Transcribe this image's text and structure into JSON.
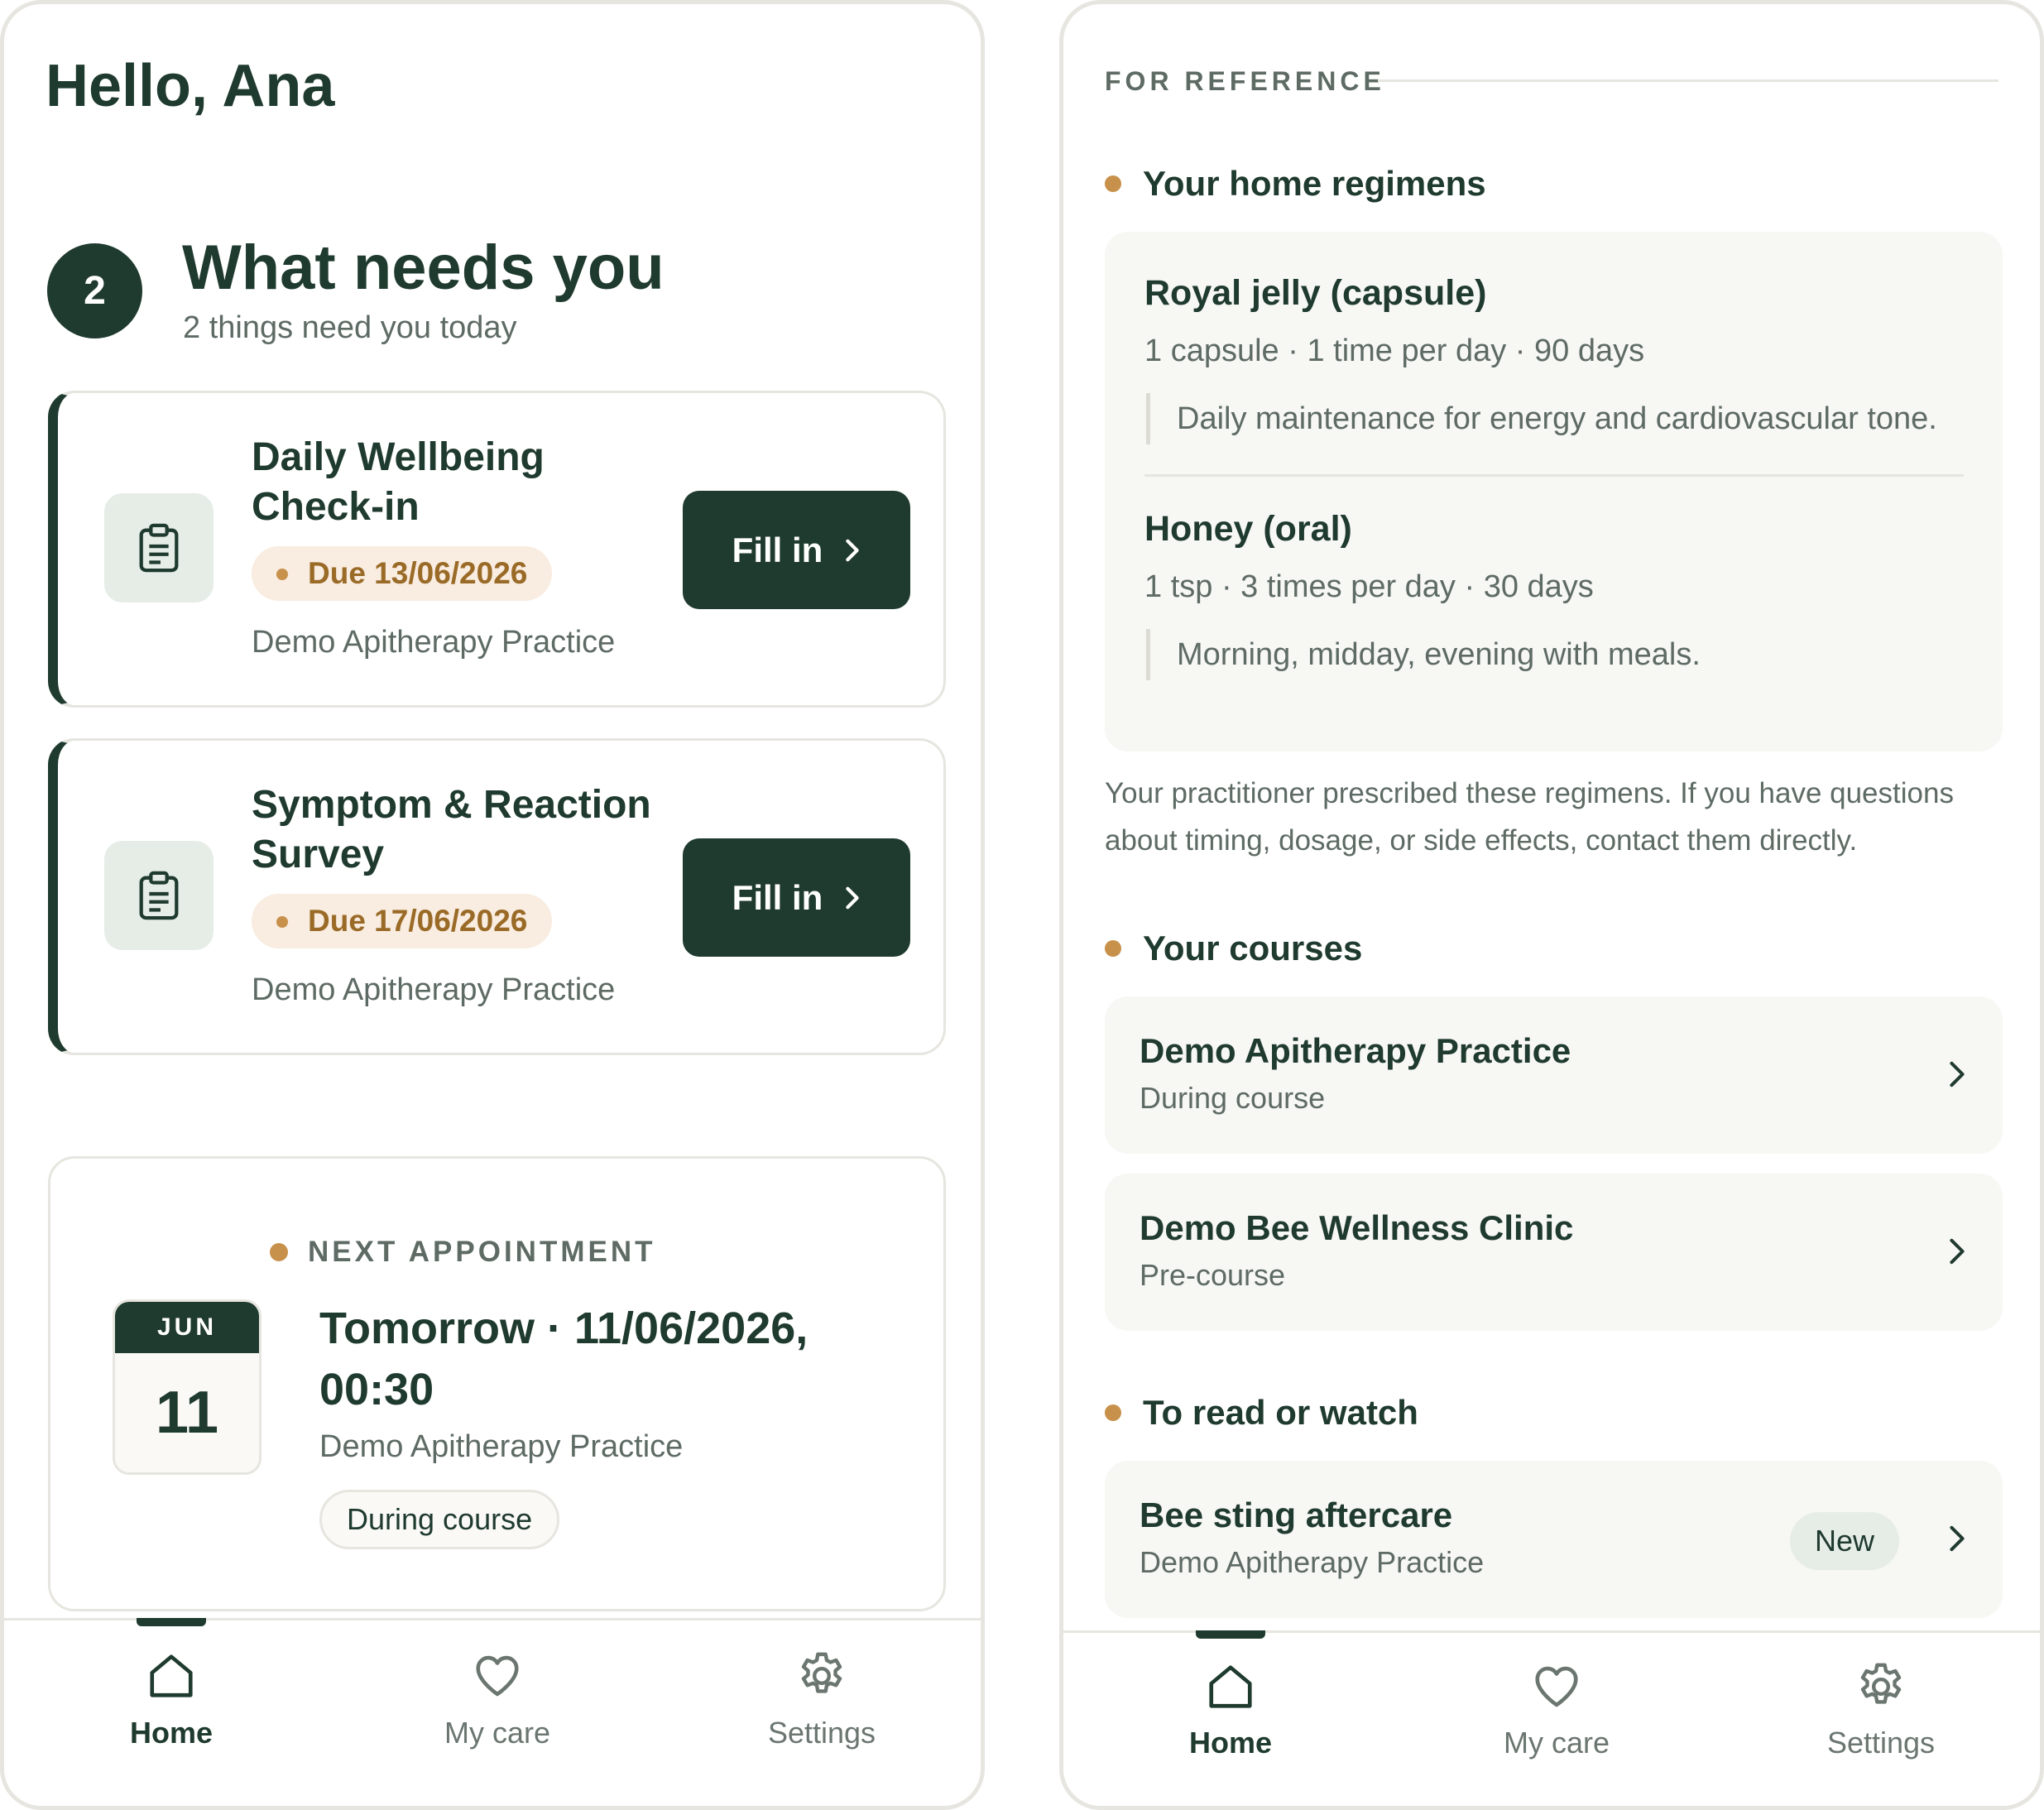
{
  "colors": {
    "primary": "#1f3a2e",
    "accent": "#c8914b",
    "due_bg": "#f9ece0",
    "due_text": "#9a6a27",
    "muted": "#5e6b64"
  },
  "left": {
    "greeting": "Hello, Ana",
    "needs": {
      "count": "2",
      "title": "What needs you",
      "subtitle": "2 things need you today"
    },
    "tasks": [
      {
        "title": "Daily Wellbeing Check-in",
        "due": "Due 13/06/2026",
        "practice": "Demo Apitherapy Practice",
        "button": "Fill in",
        "icon": "clipboard-icon"
      },
      {
        "title": "Symptom & Reaction Survey",
        "due": "Due 17/06/2026",
        "practice": "Demo Apitherapy Practice",
        "button": "Fill in",
        "icon": "clipboard-icon"
      }
    ],
    "appointment": {
      "label": "NEXT APPOINTMENT",
      "month": "JUN",
      "day": "11",
      "title": "Tomorrow · 11/06/2026, 00:30",
      "practice": "Demo Apitherapy Practice",
      "status": "During course"
    }
  },
  "tabs": [
    {
      "label": "Home",
      "icon": "home-icon",
      "active": true
    },
    {
      "label": "My care",
      "icon": "heart-icon",
      "active": false
    },
    {
      "label": "Settings",
      "icon": "gear-icon",
      "active": false
    }
  ],
  "right": {
    "reference_heading": "FOR REFERENCE",
    "regimens_title": "Your home regimens",
    "regimens": [
      {
        "name": "Royal jelly (capsule)",
        "dose": "1 capsule · 1 time per day · 90 days",
        "note": "Daily maintenance for energy and cardiovascular tone."
      },
      {
        "name": "Honey (oral)",
        "dose": "1 tsp · 3 times per day · 30 days",
        "note": "Morning, midday, evening with meals."
      }
    ],
    "regimens_note": "Your practitioner prescribed these regimens. If you have questions about timing, dosage, or side effects, contact them directly.",
    "courses_title": "Your courses",
    "courses": [
      {
        "name": "Demo Apitherapy Practice",
        "status": "During course"
      },
      {
        "name": "Demo Bee Wellness Clinic",
        "status": "Pre-course"
      }
    ],
    "read_title": "To read or watch",
    "reads": [
      {
        "title": "Bee sting aftercare",
        "source": "Demo Apitherapy Practice",
        "badge": "New"
      }
    ]
  }
}
